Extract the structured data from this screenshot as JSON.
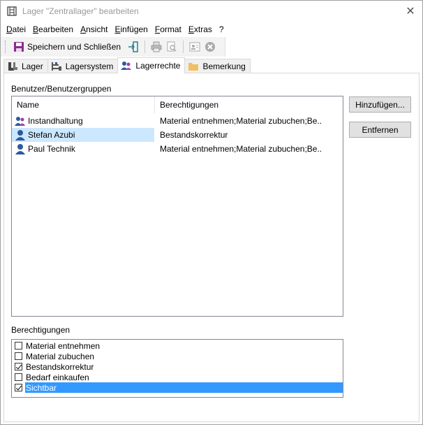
{
  "window": {
    "title": "Lager \"Zentrallager\" bearbeiten",
    "close_glyph": "✕"
  },
  "menu": [
    {
      "accel": "D",
      "rest": "atei"
    },
    {
      "accel": "B",
      "rest": "earbeiten"
    },
    {
      "accel": "A",
      "rest": "nsicht"
    },
    {
      "accel": "E",
      "rest": "infügen"
    },
    {
      "accel": "F",
      "rest": "ormat"
    },
    {
      "accel": "E",
      "rest": "xtras"
    },
    {
      "accel": "",
      "rest": "?"
    }
  ],
  "toolbar": {
    "save_close_label": "Speichern und Schließen",
    "icons": [
      "save-icon",
      "exit-icon",
      "print-icon",
      "print-preview-icon",
      "contact-card-icon",
      "cancel-icon"
    ]
  },
  "tabs": [
    {
      "label": "Lager",
      "icon": "boots-icon",
      "active": false
    },
    {
      "label": "Lagersystem",
      "icon": "shelf-icon",
      "active": false
    },
    {
      "label": "Lagerrechte",
      "icon": "users-icon",
      "active": true
    },
    {
      "label": "Bemerkung",
      "icon": "folder-icon",
      "active": false
    }
  ],
  "users_section": {
    "label": "Benutzer/Benutzergruppen",
    "columns": {
      "name": "Name",
      "permissions": "Berechtigungen"
    },
    "rows": [
      {
        "name": "Instandhaltung",
        "type": "group",
        "permissions": "Material entnehmen;Material zubuchen;Be...",
        "selected": false
      },
      {
        "name": "Stefan Azubi",
        "type": "user",
        "permissions": "Bestandskorrektur",
        "selected": true
      },
      {
        "name": "Paul Technik",
        "type": "user",
        "permissions": "Material entnehmen;Material zubuchen;Be...",
        "selected": false
      }
    ]
  },
  "buttons": {
    "add": "Hinzufügen...",
    "remove": "Entfernen"
  },
  "permissions_section": {
    "label": "Berechtigungen",
    "items": [
      {
        "label": "Material entnehmen",
        "checked": false,
        "selected": false
      },
      {
        "label": "Material zubuchen",
        "checked": false,
        "selected": false
      },
      {
        "label": "Bestandskorrektur",
        "checked": true,
        "selected": false
      },
      {
        "label": "Bedarf einkaufen",
        "checked": false,
        "selected": false
      },
      {
        "label": "Sichtbar",
        "checked": true,
        "selected": true
      }
    ]
  },
  "colors": {
    "selection_light": "#cce8ff",
    "selection_strong": "#3399ff",
    "save_icon": "#8b2b8f",
    "user_icon": "#2c5aa0"
  }
}
